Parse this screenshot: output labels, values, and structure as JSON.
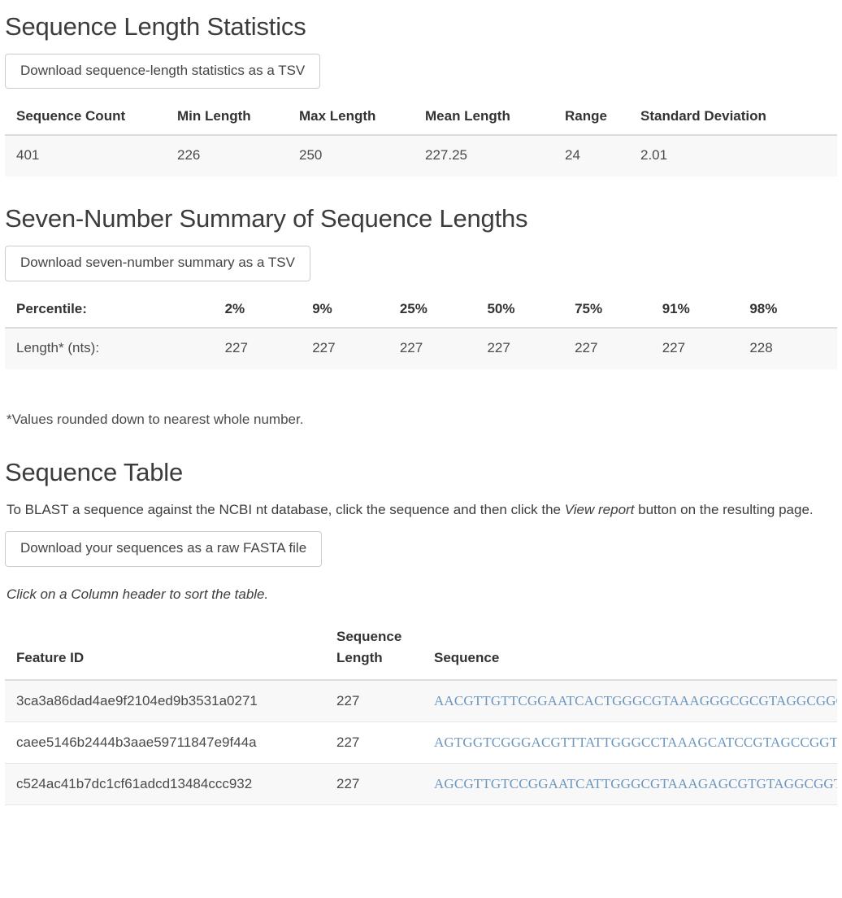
{
  "stats_section": {
    "title": "Sequence Length Statistics",
    "download_button": "Download sequence-length statistics as a TSV",
    "headers": [
      "Sequence Count",
      "Min Length",
      "Max Length",
      "Mean Length",
      "Range",
      "Standard Deviation"
    ],
    "row": [
      "401",
      "226",
      "250",
      "227.25",
      "24",
      "2.01"
    ]
  },
  "summary_section": {
    "title": "Seven-Number Summary of Sequence Lengths",
    "download_button": "Download seven-number summary as a TSV",
    "row_header_label": "Percentile:",
    "percentiles": [
      "2%",
      "9%",
      "25%",
      "50%",
      "75%",
      "91%",
      "98%"
    ],
    "value_label": "Length* (nts):",
    "values": [
      "227",
      "227",
      "227",
      "227",
      "227",
      "227",
      "228"
    ],
    "footnote": "*Values rounded down to nearest whole number."
  },
  "sequence_section": {
    "title": "Sequence Table",
    "intro_prefix": "To BLAST a sequence against the NCBI nt database, click the sequence and then click the ",
    "intro_emphasis": "View report",
    "intro_suffix": " button on the resulting page.",
    "download_button": "Download your sequences as a raw FASTA file",
    "sort_hint": "Click on a Column header to sort the table.",
    "headers": [
      "Feature ID",
      "Sequence Length",
      "Sequence"
    ],
    "header_seq_length_line1": "Sequence",
    "header_seq_length_line2": "Length",
    "rows": [
      {
        "feature_id": "3ca3a86dad4ae9f2104ed9b3531a0271",
        "length": "227",
        "sequence": "AACGTTGTTCGGAATCACTGGGCGTAAAGGGCGCGTAGGCGGGAACGT"
      },
      {
        "feature_id": "caee5146b2444b3aae59711847e9f44a",
        "length": "227",
        "sequence": "AGTGGTCGGGACGTTTATTGGGCCTAAAGCATCCGTAGCCGGTTCTAC"
      },
      {
        "feature_id": "c524ac41b7dc1cf61adcd13484ccc932",
        "length": "227",
        "sequence": "AGCGTTGTCCGGAATCATTGGGCGTAAAGAGCGTGTAGGCGGTCCGGT"
      }
    ]
  },
  "colors": {
    "sequence_link": "#6b96bf",
    "heading": "#3c3c3c",
    "row_stripe": "#f8f8f8",
    "border": "#dcdcdc"
  }
}
